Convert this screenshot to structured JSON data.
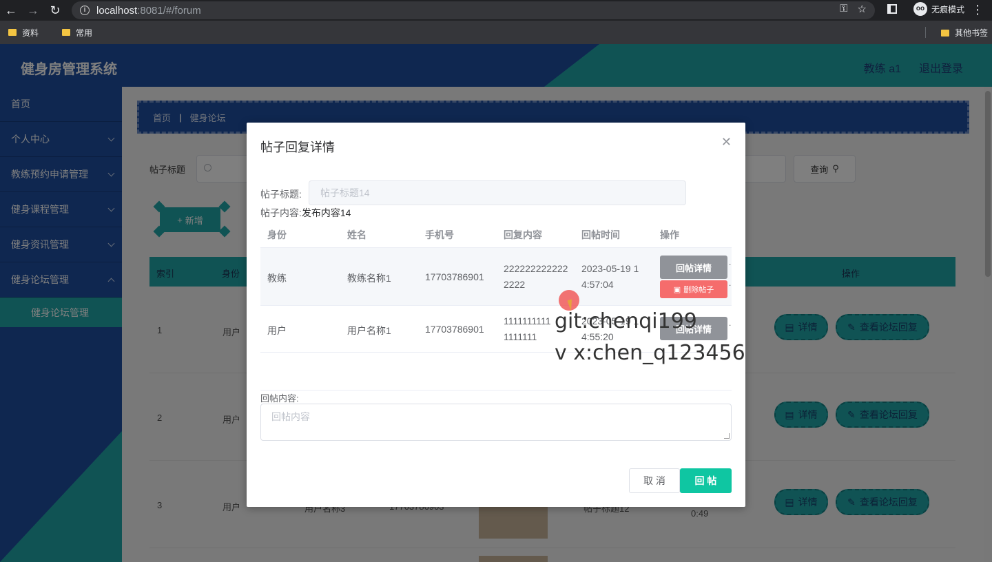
{
  "browser": {
    "url_host": "localhost",
    "url_path": ":8081/#/forum",
    "incognito_label": "无痕模式",
    "bookmarks": [
      "资料",
      "常用"
    ],
    "other_bookmarks": "其他书签"
  },
  "header": {
    "app_title": "健身房管理系统",
    "user": "教练 a1",
    "logout": "退出登录"
  },
  "sidebar": {
    "items": [
      {
        "label": "首页"
      },
      {
        "label": "个人中心"
      },
      {
        "label": "教练预约申请管理"
      },
      {
        "label": "健身课程管理"
      },
      {
        "label": "健身资讯管理"
      },
      {
        "label": "健身论坛管理"
      }
    ],
    "subitem": "健身论坛管理"
  },
  "main": {
    "breadcrumb": [
      "首页",
      "健身论坛"
    ],
    "breadcrumb_sep": "|",
    "search_label": "帖子标题",
    "query_button": "查询",
    "new_button": "新增",
    "table_headers": {
      "index": "索引",
      "identity": "身份",
      "actions": "操作"
    },
    "rows": [
      {
        "index": "1",
        "identity": "用户"
      },
      {
        "index": "2",
        "identity": "用户"
      },
      {
        "index": "3",
        "identity": "用户",
        "name_partial": "用户名称3",
        "phone_partial": "17703786903",
        "title_partial": "帖子标题12",
        "time_partial": "0:49"
      }
    ],
    "detail_button": "详情",
    "view_reply_button": "查看论坛回复"
  },
  "dialog": {
    "title": "帖子回复详情",
    "post_title_label": "帖子标题:",
    "post_title_value": "帖子标题14",
    "post_content_label": "帖子内容:",
    "post_content_value": "发布内容14",
    "columns": [
      "身份",
      "姓名",
      "手机号",
      "回复内容",
      "回帖时间",
      "操作"
    ],
    "replies": [
      {
        "identity": "教练",
        "name": "教练名称1",
        "phone": "17703786901",
        "content_l1": "222222222222",
        "content_l2": "2222",
        "time_l1": "2023-05-19 1",
        "time_l2": "4:57:04"
      },
      {
        "identity": "用户",
        "name": "用户名称1",
        "phone": "17703786901",
        "content_l1": "1111111111",
        "content_l2": "1111111",
        "time_l1": "2023-05-19 1",
        "time_l2": "4:55:20"
      }
    ],
    "reply_detail_button": "回帖详情",
    "delete_button": "删除帖子",
    "reply_label": "回帖内容:",
    "reply_placeholder": "回帖内容",
    "cancel_button": "取 消",
    "submit_button": "回 帖"
  },
  "watermark": {
    "line1": "git:chenqi199",
    "line2": "v x:chen_q123456"
  }
}
